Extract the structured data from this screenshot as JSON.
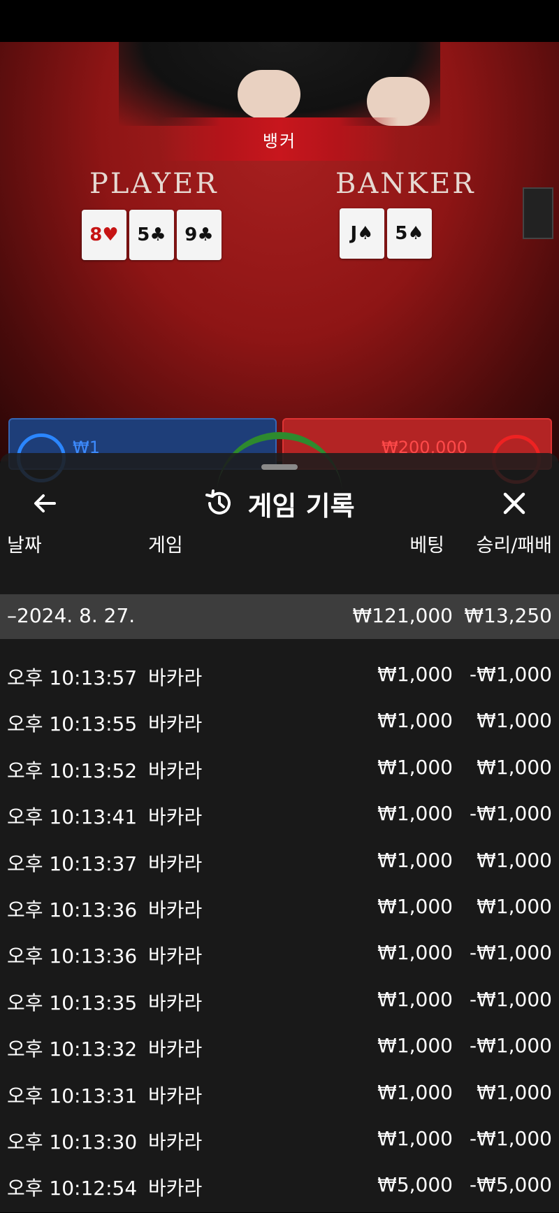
{
  "game": {
    "banner": "뱅커",
    "player_label": "PLAYER",
    "banker_label": "BANKER",
    "player_cards": [
      {
        "rank": "8",
        "suit": "♥",
        "red": true
      },
      {
        "rank": "5",
        "suit": "♣",
        "red": false
      },
      {
        "rank": "9",
        "suit": "♣",
        "red": false
      }
    ],
    "banker_cards": [
      {
        "rank": "J",
        "suit": "♠",
        "red": false
      },
      {
        "rank": "5",
        "suit": "♠",
        "red": false
      }
    ],
    "player_bet": "₩1",
    "banker_bet": "₩200,000"
  },
  "modal": {
    "title": "게임 기록",
    "back_icon": "arrow-left-icon",
    "history_icon": "history-clock-icon",
    "close_icon": "close-icon",
    "columns": {
      "date": "날짜",
      "game": "게임",
      "bet": "베팅",
      "result": "승리/패배"
    },
    "summary": {
      "date": "–2024. 8. 27.",
      "bet": "₩121,000",
      "result": "₩13,250"
    },
    "rows": [
      {
        "time": "오후 10:13:57",
        "game": "바카라",
        "bet": "₩1,000",
        "result": "-₩1,000"
      },
      {
        "time": "오후 10:13:55",
        "game": "바카라",
        "bet": "₩1,000",
        "result": "₩1,000"
      },
      {
        "time": "오후 10:13:52",
        "game": "바카라",
        "bet": "₩1,000",
        "result": "₩1,000"
      },
      {
        "time": "오후 10:13:41",
        "game": "바카라",
        "bet": "₩1,000",
        "result": "-₩1,000"
      },
      {
        "time": "오후 10:13:37",
        "game": "바카라",
        "bet": "₩1,000",
        "result": "₩1,000"
      },
      {
        "time": "오후 10:13:36",
        "game": "바카라",
        "bet": "₩1,000",
        "result": "₩1,000"
      },
      {
        "time": "오후 10:13:36",
        "game": "바카라",
        "bet": "₩1,000",
        "result": "-₩1,000"
      },
      {
        "time": "오후 10:13:35",
        "game": "바카라",
        "bet": "₩1,000",
        "result": "-₩1,000"
      },
      {
        "time": "오후 10:13:32",
        "game": "바카라",
        "bet": "₩1,000",
        "result": "-₩1,000"
      },
      {
        "time": "오후 10:13:31",
        "game": "바카라",
        "bet": "₩1,000",
        "result": "₩1,000"
      },
      {
        "time": "오후 10:13:30",
        "game": "바카라",
        "bet": "₩1,000",
        "result": "-₩1,000"
      },
      {
        "time": "오후 10:12:54",
        "game": "바카라",
        "bet": "₩5,000",
        "result": "-₩5,000"
      }
    ]
  }
}
